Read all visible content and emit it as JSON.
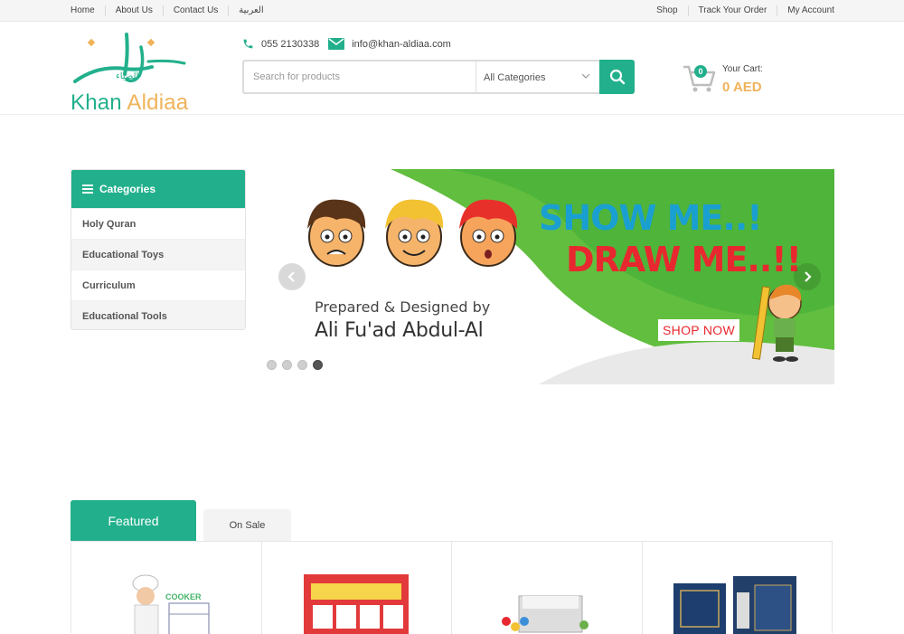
{
  "topbar": {
    "left": [
      "Home",
      "About Us",
      "Contact Us",
      "العربية"
    ],
    "right": [
      "Shop",
      "Track Your Order",
      "My Account"
    ]
  },
  "brand": {
    "name_part1": "Khan",
    "name_part2": "Aldiaa",
    "primary_color": "#22b08c",
    "accent_color": "#f0b35a"
  },
  "contact": {
    "phone": "055 2130338",
    "email": "info@khan-aldiaa.com"
  },
  "search": {
    "placeholder": "Search for products",
    "category": "All Categories"
  },
  "cart": {
    "count": "0",
    "label": "Your Cart:",
    "amount": "0 AED"
  },
  "categories": {
    "title": "Categories",
    "items": [
      "Holy Quran",
      "Educational Toys",
      "Curriculum",
      "Educational Tools"
    ]
  },
  "slider": {
    "headline1": "SHOW ME..!",
    "headline2": "DRAW ME..!!",
    "prepared": "Prepared & Designed by",
    "author": "Ali Fu'ad Abdul-Al",
    "cta": "SHOP NOW",
    "slide_count": 4,
    "active_slide": 4
  },
  "tabs": {
    "featured": "Featured",
    "on_sale": "On Sale"
  },
  "products": [
    {
      "thumb_text": "COOKER"
    },
    {
      "thumb_text": ""
    },
    {
      "thumb_text": ""
    },
    {
      "thumb_text": ""
    }
  ]
}
